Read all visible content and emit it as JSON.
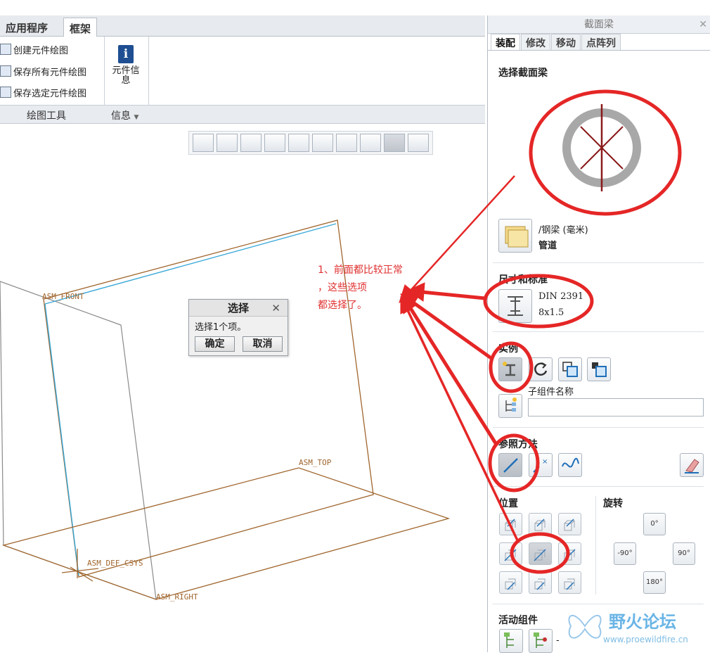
{
  "ribbon": {
    "tabs": [
      "应用程序",
      "框架"
    ],
    "commands": [
      "创建元件绘图",
      "保存所有元件绘图",
      "保存选定元件绘图"
    ],
    "info_button": "元件信息",
    "groups": [
      "绘图工具",
      "信息"
    ]
  },
  "viewport": {
    "datums": [
      "ASM_FRONT",
      "ASM_TOP",
      "ASM_DEF_CSYS",
      "ASM_RIGHT"
    ],
    "toolbar_icons": [
      "refit-icon",
      "zoom-in-icon",
      "zoom-out-icon",
      "repaint-icon",
      "display-style-icon",
      "saved-views-icon",
      "view-manager-icon",
      "datum-display-icon",
      "spin-center-icon",
      "annotation-display-icon"
    ]
  },
  "select_dialog": {
    "title": "选择",
    "message": "选择1个项。",
    "ok": "确定",
    "cancel": "取消"
  },
  "annotation": "1、前面都比较正常\n，这些选项\n都选择了。",
  "panel": {
    "title": "截面梁",
    "tabs": [
      "装配",
      "修改",
      "移动",
      "点阵列"
    ],
    "select_beam_heading": "选择截面梁",
    "beam_library": "/钢梁 (毫米)",
    "beam_type": "管道",
    "size_heading": "尺寸和标准",
    "standard": "DIN 2391",
    "size": "8x1.5",
    "instance_heading": "实例",
    "subassembly_label": "子组件名称",
    "subassembly_value": "",
    "reference_heading": "参照方法",
    "position_heading": "位置",
    "rotation_heading": "旋转",
    "rotations": [
      "0°",
      "-90°",
      "90°",
      "180°"
    ],
    "active_component_heading": "活动组件",
    "active_component_value": "-"
  },
  "watermark": {
    "name": "野火论坛",
    "url": "www.proewildfire.cn"
  },
  "colors": {
    "annotation_red": "#e03030",
    "datum_brown": "#a0662e",
    "highlight_cyan": "#3aa8d8"
  }
}
